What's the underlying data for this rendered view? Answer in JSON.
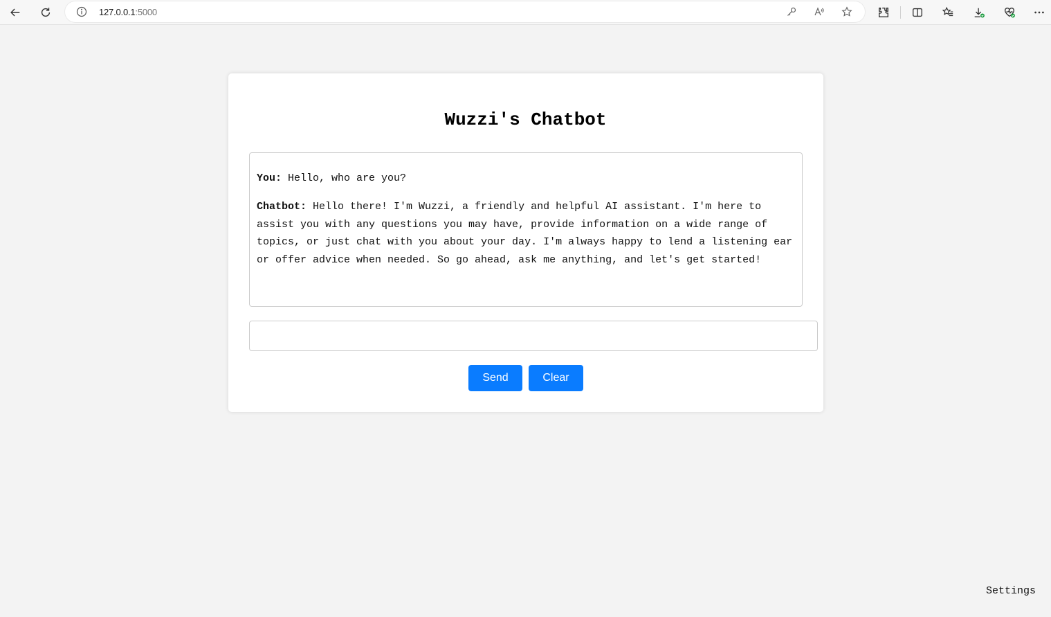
{
  "browser": {
    "url_host": "127.0.0.1",
    "url_port": ":5000"
  },
  "chat": {
    "title": "Wuzzi's Chatbot",
    "messages": [
      {
        "sender": "You:",
        "text": " Hello, who are you?"
      },
      {
        "sender": "Chatbot:",
        "text": " Hello there! I'm Wuzzi, a friendly and helpful AI assistant. I'm here to assist you with any questions you may have, provide information on a wide range of topics, or just chat with you about your day. I'm always happy to lend a listening ear or offer advice when needed. So go ahead, ask me anything, and let's get started!"
      }
    ],
    "input_value": "",
    "send_label": "Send",
    "clear_label": "Clear"
  },
  "footer": {
    "settings_label": "Settings"
  },
  "colors": {
    "button": "#0a7cff",
    "page_background": "#f3f3f3"
  }
}
